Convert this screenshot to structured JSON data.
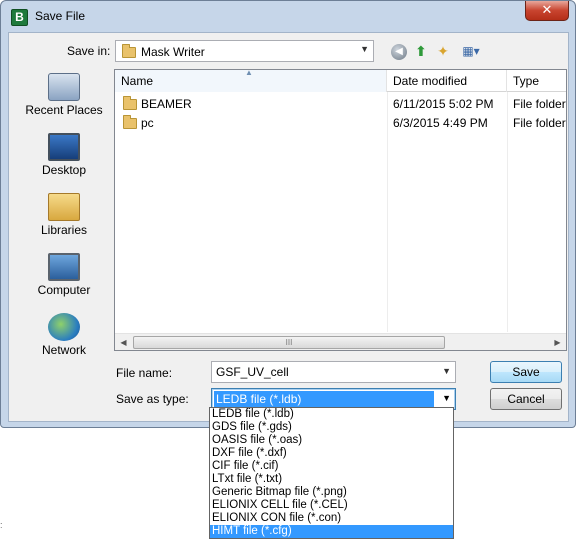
{
  "window": {
    "title": "Save File",
    "app_icon_letter": "B",
    "close_label": "✕"
  },
  "save_in": {
    "label": "Save in:",
    "value": "Mask Writer"
  },
  "toolbar": {
    "back_icon": "back-arrow-icon",
    "up_icon": "up-folder-icon",
    "new_folder_icon": "new-folder-icon",
    "views_icon": "view-menu-icon"
  },
  "places": [
    {
      "label": "Recent Places",
      "icon": "recent-places-icon"
    },
    {
      "label": "Desktop",
      "icon": "desktop-icon"
    },
    {
      "label": "Libraries",
      "icon": "libraries-icon"
    },
    {
      "label": "Computer",
      "icon": "computer-icon"
    },
    {
      "label": "Network",
      "icon": "network-icon"
    }
  ],
  "file_list": {
    "columns": [
      "Name",
      "Date modified",
      "Type"
    ],
    "rows": [
      {
        "name": "BEAMER",
        "date": "6/11/2015 5:02 PM",
        "type": "File folder"
      },
      {
        "name": "pc",
        "date": "6/3/2015 4:49 PM",
        "type": "File folder"
      }
    ],
    "scroll_thumb_glyph": "III"
  },
  "file_name": {
    "label": "File name:",
    "value": "GSF_UV_cell"
  },
  "save_as_type": {
    "label": "Save as type:",
    "selected": "LEDB file (*.ldb)",
    "options": [
      "LEDB file (*.ldb)",
      "GDS file (*.gds)",
      "OASIS file (*.oas)",
      "DXF file (*.dxf)",
      "CIF file (*.cif)",
      "LTxt file (*.txt)",
      "Generic Bitmap file (*.png)",
      "ELIONIX CELL file (*.CEL)",
      "ELIONIX CON file (*.con)",
      "HIMT file (*.cfg)"
    ],
    "highlighted_option": "HIMT file (*.cfg)"
  },
  "buttons": {
    "save": "Save",
    "cancel": "Cancel"
  },
  "stray_mark": ":",
  "colors": {
    "selection": "#3399ff",
    "frame": "#c6d6e9",
    "close_button": "#c8442f"
  }
}
